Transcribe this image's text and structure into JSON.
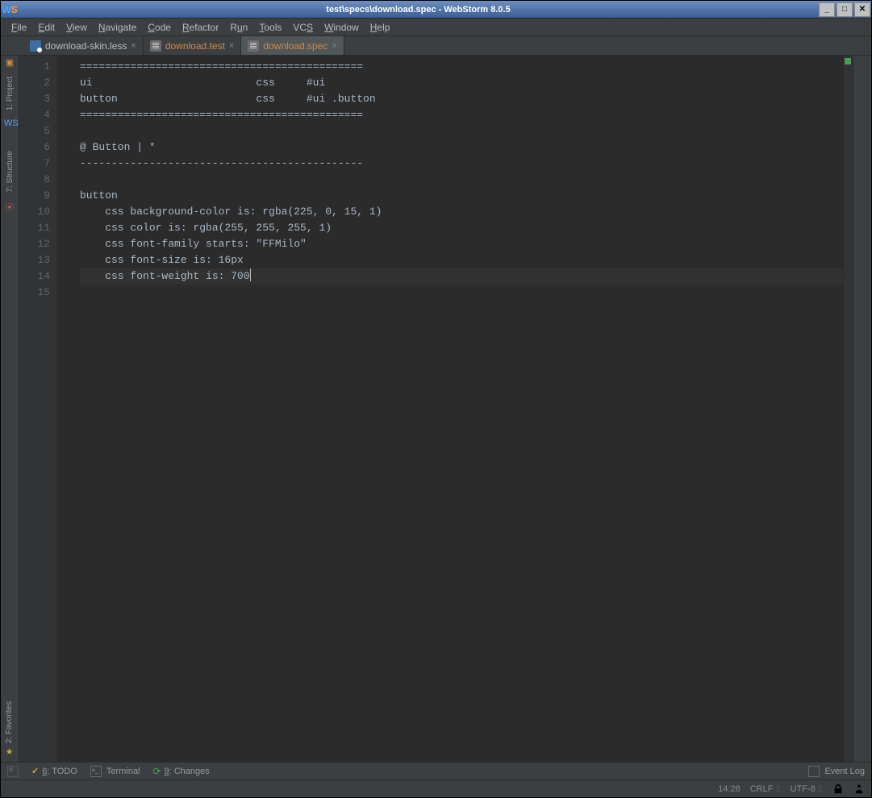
{
  "titlebar": {
    "title": "test\\specs\\download.spec - WebStorm 8.0.5"
  },
  "menu": {
    "file": "File",
    "edit": "Edit",
    "view": "View",
    "navigate": "Navigate",
    "code": "Code",
    "refactor": "Refactor",
    "run": "Run",
    "tools": "Tools",
    "vcs": "VCS",
    "window": "Window",
    "help": "Help"
  },
  "tabs": [
    {
      "name": "download-skin.less",
      "class": "",
      "orange": false
    },
    {
      "name": "download.test",
      "class": "",
      "orange": true
    },
    {
      "name": "download.spec",
      "class": "active",
      "orange": true
    }
  ],
  "sidebar": {
    "project": "1: Project",
    "structure": "7: Structure",
    "favorites": "2: Favorites"
  },
  "editor": {
    "lines": [
      "=============================================",
      "ui                          css     #ui",
      "button                      css     #ui .button",
      "=============================================",
      "",
      "@ Button | *",
      "---------------------------------------------",
      "",
      "button",
      "    css background-color is: rgba(225, 0, 15, 1)",
      "    css color is: rgba(255, 255, 255, 1)",
      "    css font-family starts: \"FFMilo\"",
      "    css font-size is: 16px",
      "    css font-weight is: 700",
      ""
    ],
    "current_line": 14
  },
  "bottombar": {
    "todo": "6: TODO",
    "terminal": "Terminal",
    "changes": "9: Changes",
    "eventlog": "Event Log"
  },
  "status": {
    "pos": "14:28",
    "lineend": "CRLF",
    "encoding": "UTF-8"
  }
}
